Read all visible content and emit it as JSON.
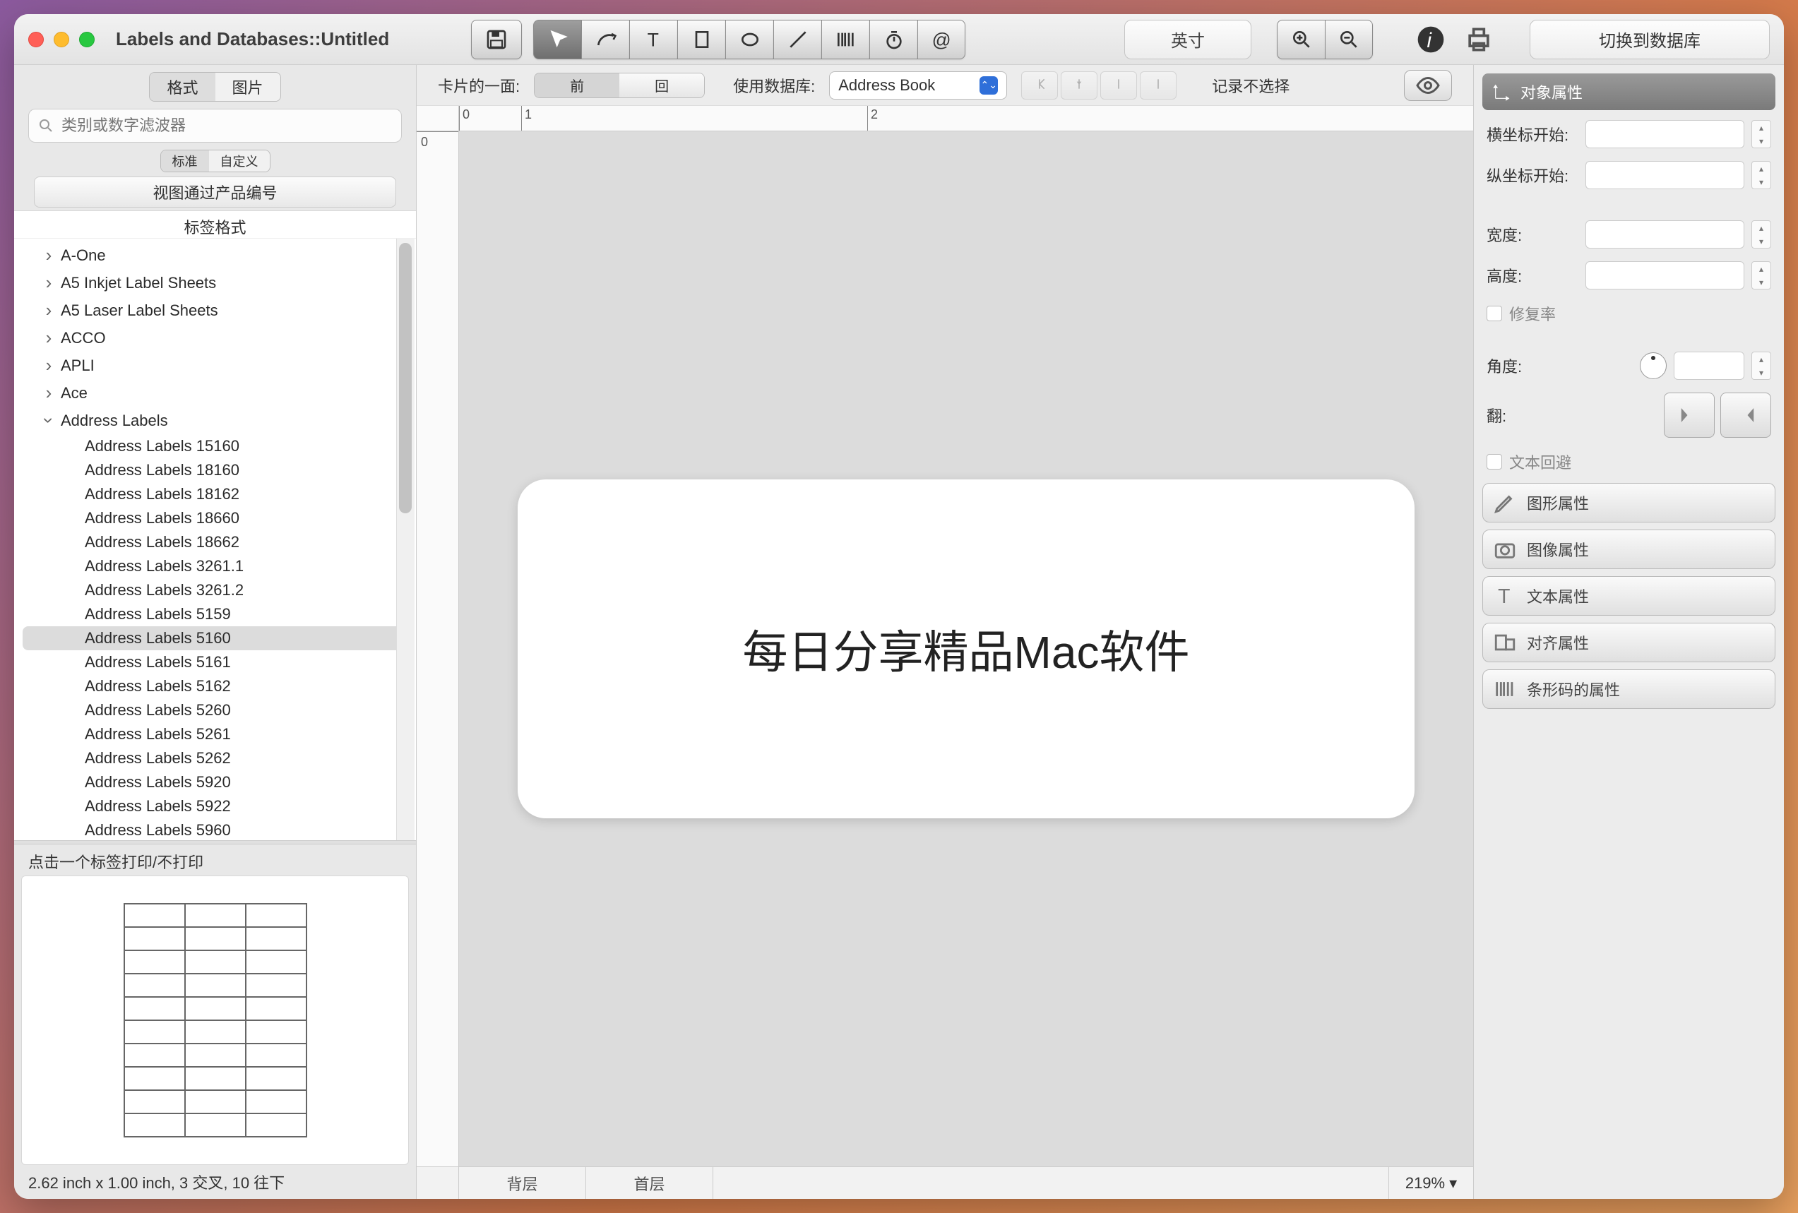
{
  "window": {
    "title": "Labels and  Databases::Untitled"
  },
  "titlebar": {
    "unit": "英寸",
    "switch_db": "切换到数据库"
  },
  "left": {
    "tabs": {
      "format": "格式",
      "image": "图片"
    },
    "search_placeholder": "类别或数字滤波器",
    "subtabs": {
      "standard": "标准",
      "custom": "自定义"
    },
    "view_by": "视图通过产品编号",
    "label_header": "标签格式",
    "categories": [
      "A-One",
      "A5 Inkjet Label Sheets",
      "A5 Laser Label Sheets",
      "ACCO",
      "APLI",
      "Ace"
    ],
    "open_category": "Address Labels",
    "items": [
      "Address Labels 15160",
      "Address Labels 18160",
      "Address Labels 18162",
      "Address Labels 18660",
      "Address Labels 18662",
      "Address Labels 3261.1",
      "Address Labels 3261.2",
      "Address Labels 5159",
      "Address Labels 5160",
      "Address Labels 5161",
      "Address Labels 5162",
      "Address Labels 5260",
      "Address Labels 5261",
      "Address Labels 5262",
      "Address Labels 5920",
      "Address Labels 5922",
      "Address Labels 5960"
    ],
    "selected_item": "Address Labels 5160",
    "preview_hint": "点击一个标签打印/不打印",
    "status": "2.62 inch x 1.00 inch, 3 交叉, 10 往下"
  },
  "center": {
    "side_label": "卡片的一面:",
    "front": "前",
    "back": "回",
    "use_db": "使用数据库:",
    "db_value": "Address Book",
    "record_status": "记录不选择",
    "canvas_text": "每日分享精品Mac软件",
    "ruler_h": [
      "0",
      "1",
      "2"
    ],
    "ruler_v": [
      "0"
    ],
    "bottom_tabs": {
      "back": "背层",
      "front": "首层"
    },
    "zoom": "219%"
  },
  "right": {
    "panel_title": "对象属性",
    "x_label": "横坐标开始:",
    "y_label": "纵坐标开始:",
    "w_label": "宽度:",
    "h_label": "高度:",
    "fix_ratio": "修复率",
    "angle_label": "角度:",
    "flip_label": "翻:",
    "text_wrap": "文本回避",
    "sections": {
      "shape": "图形属性",
      "image": "图像属性",
      "text": "文本属性",
      "align": "对齐属性",
      "barcode": "条形码的属性"
    }
  }
}
